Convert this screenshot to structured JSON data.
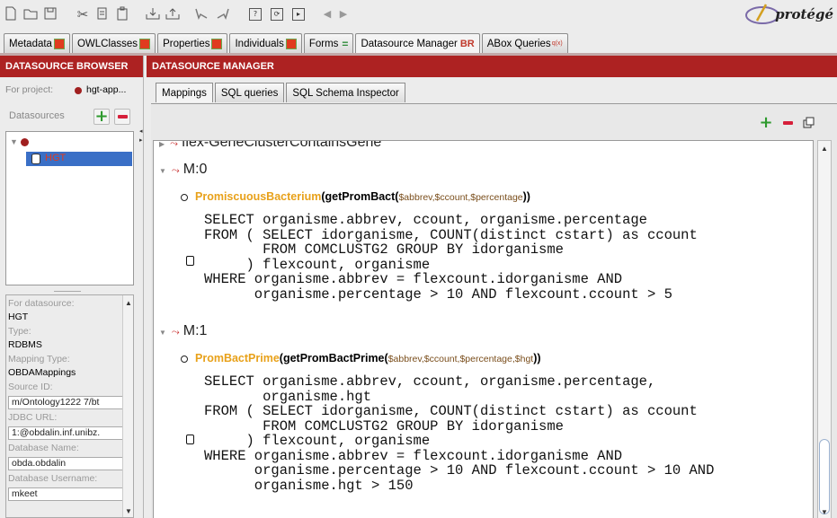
{
  "toolbar": {
    "buttons": [
      "new-file-icon",
      "open-folder-icon",
      "save-icon",
      "cut-icon",
      "copy-icon",
      "paste-icon",
      "import-icon",
      "export-icon",
      "undo-icon",
      "redo-icon",
      "nav-help-icon",
      "nav-step-icon",
      "nav-run-icon",
      "back-icon",
      "forward-icon"
    ],
    "glyph_back": "◀",
    "glyph_forward": "▶",
    "brand": "protégé"
  },
  "tabs": [
    {
      "label": "Metadata",
      "mark": "red"
    },
    {
      "label": "OWLClasses",
      "mark": "red"
    },
    {
      "label": "Properties",
      "mark": "red"
    },
    {
      "label": "Individuals",
      "mark": "red"
    },
    {
      "label": "Forms",
      "mark": "eq"
    },
    {
      "label": "Datasource Manager",
      "mark": "badge",
      "badge": "BR"
    },
    {
      "label": "ABox Queries",
      "mark": "sup",
      "sup": "q(x)"
    }
  ],
  "left": {
    "title": "DATASOURCE BROWSER",
    "project_label": "For project:",
    "project_value": "hgt-app...",
    "datasources_label": "Datasources",
    "tree_root_toggle": "▼",
    "tree_item": "HGT",
    "props": {
      "for_datasource_label": "For datasource:",
      "for_datasource_value": "HGT",
      "type_label": "Type:",
      "type_value": "RDBMS",
      "mapping_type_label": "Mapping Type:",
      "mapping_type_value": "OBDAMappings",
      "source_id_label": "Source ID:",
      "source_id_value": "m/Ontology1222 7/bt",
      "jdbc_url_label": "JDBC URL:",
      "jdbc_url_value": "1:@obdalin.inf.unibz.",
      "db_name_label": "Database Name:",
      "db_name_value": "obda.obdalin",
      "db_user_label": "Database Username:",
      "db_user_value": "mkeet"
    }
  },
  "main": {
    "title": "DATASOURCE MANAGER",
    "subtabs": [
      "Mappings",
      "SQL queries",
      "SQL Schema Inspector"
    ],
    "mappings": [
      {
        "id": "flex-GeneClusterContainsGene",
        "toggle": "▶"
      },
      {
        "id": "M:0",
        "toggle": "▼",
        "target_class": "PromiscuousBacterium",
        "target_fn": "getPromBact",
        "target_args": "$abbrev,$ccount,$percentage",
        "sql": "SELECT organisme.abbrev, ccount, organisme.percentage\nFROM ( SELECT idorganisme, COUNT(distinct cstart) as ccount\n       FROM COMCLUSTG2 GROUP BY idorganisme\n     ) flexcount, organisme\nWHERE organisme.abbrev = flexcount.idorganisme AND\n      organisme.percentage > 10 AND flexcount.ccount > 5"
      },
      {
        "id": "M:1",
        "toggle": "▼",
        "target_class": "PromBactPrime",
        "target_fn": "getPromBactPrime",
        "target_args": "$abbrev,$ccount,$percentage,$hgt",
        "sql": "SELECT organisme.abbrev, ccount, organisme.percentage,\n       organisme.hgt\nFROM ( SELECT idorganisme, COUNT(distinct cstart) as ccount\n       FROM COMCLUSTG2 GROUP BY idorganisme\n     ) flexcount, organisme\nWHERE organisme.abbrev = flexcount.idorganisme AND\n      organisme.percentage > 10 AND flexcount.ccount > 10 AND\n      organisme.hgt > 150"
      }
    ]
  },
  "colors": {
    "panel_header": "#ad2222",
    "selection": "#3a6fc6",
    "class_name": "#e8a11a",
    "add": "#2e9a2e",
    "remove": "#d61f3a"
  }
}
